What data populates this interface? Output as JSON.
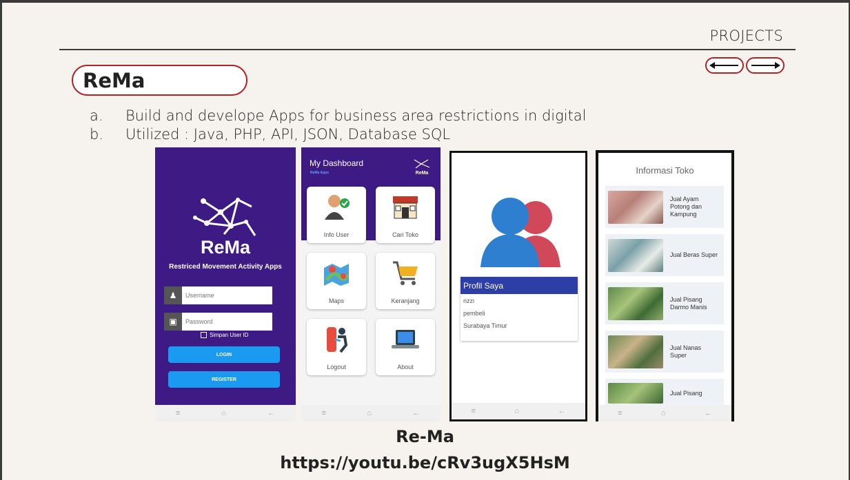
{
  "header": {
    "section": "PROJECTS"
  },
  "title": "ReMa",
  "bullets": [
    {
      "marker": "a.",
      "text": "Build and develope Apps for business area restrictions in digital"
    },
    {
      "marker": "b.",
      "text": "Utilized : Java, PHP, API, JSON, Database SQL"
    }
  ],
  "login": {
    "brand": "ReMa",
    "subtitle": "Restriced Movement Activity Apps",
    "username_placeholder": "Username",
    "password_placeholder": "Password",
    "remember": "Simpan User ID",
    "login_button": "LOGIN",
    "register_button": "REGISTER"
  },
  "dashboard": {
    "title": "My Dashboard",
    "subtitle": "ReMa Apps",
    "logo": "ReMa",
    "cards": [
      "Info User",
      "Cari Toko",
      "Maps",
      "Keranjang",
      "Logout",
      "About"
    ]
  },
  "profile": {
    "header": "Profil Saya",
    "rows": [
      "rizzi",
      "pembeli",
      "Surabaya Timur"
    ]
  },
  "shops": {
    "title": "Informasi Toko",
    "items": [
      "Jual Ayam Potong dan Kampung",
      "Jual Beras Super",
      "Jual Pisang Darmo Manis",
      "Jual Nanas Super",
      "Jual Pisang"
    ]
  },
  "navbar": {
    "icons": [
      "menu-icon",
      "home-icon",
      "back-icon"
    ]
  },
  "caption": {
    "title": "Re-Ma",
    "link": "https://youtu.be/cRv3ugX5HsM"
  },
  "colors": {
    "accent": "#b32222",
    "app_purple": "#3e1a84",
    "app_blue": "#1a9af0",
    "profile_blue": "#2d3ea6"
  }
}
